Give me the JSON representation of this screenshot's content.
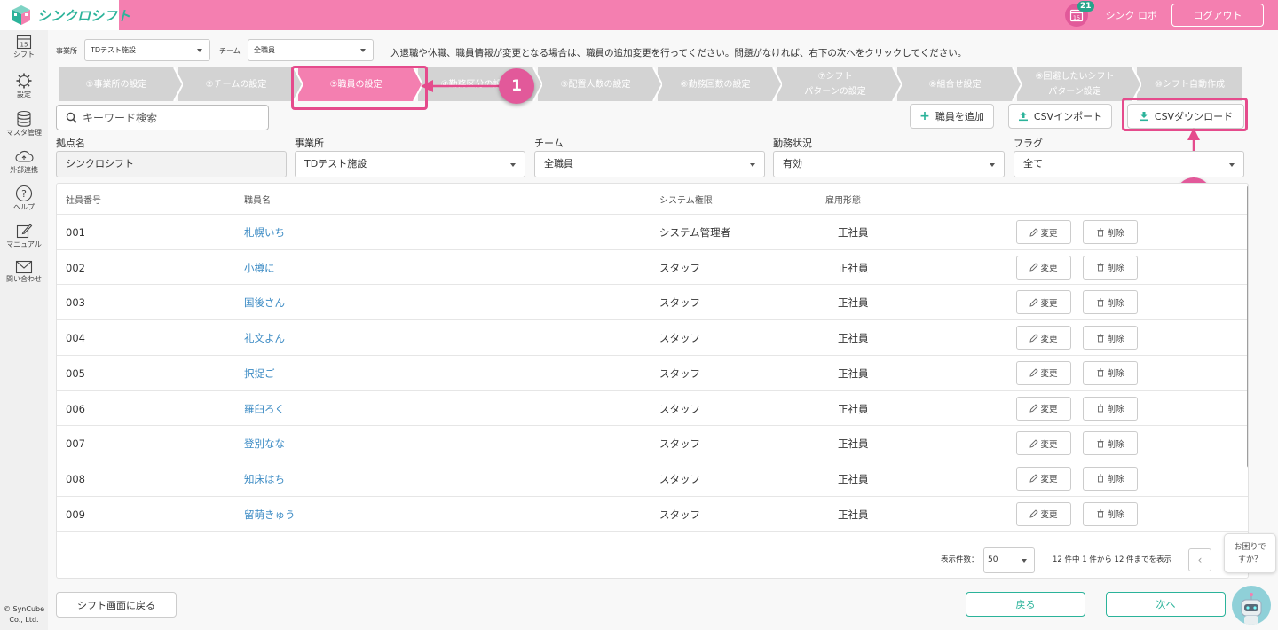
{
  "app": {
    "logo_text": "シンクロシフト",
    "calendar_day": "15",
    "notification_count": "21",
    "user_name": "シンク ロボ",
    "logout_label": "ログアウト"
  },
  "sidebar": {
    "items": [
      {
        "label": "シフト",
        "icon": "calendar-icon",
        "calendar_day": "15"
      },
      {
        "label": "設定",
        "icon": "gear-icon"
      },
      {
        "label": "マスタ管理",
        "icon": "database-icon"
      },
      {
        "label": "外部連携",
        "icon": "cloud-icon"
      },
      {
        "label": "ヘルプ",
        "icon": "help-icon"
      },
      {
        "label": "マニュアル",
        "icon": "manual-icon"
      },
      {
        "label": "問い合わせ",
        "icon": "mail-icon"
      }
    ],
    "copyright_line1": "© SynCube",
    "copyright_line2": "Co., Ltd."
  },
  "top_filter": {
    "office_label": "事業所",
    "office_value": "TDテスト施設",
    "team_label": "チーム",
    "team_value": "全職員",
    "notice": "入退職や休職、職員情報が変更となる場合は、職員の追加変更を行ってください。問題がなければ、右下の次へをクリックしてください。"
  },
  "steps": [
    {
      "line1": "①事業所の設定",
      "line2": ""
    },
    {
      "line1": "②チームの設定",
      "line2": ""
    },
    {
      "line1": "③職員の設定",
      "line2": ""
    },
    {
      "line1": "④勤務区分の設定",
      "line2": ""
    },
    {
      "line1": "⑤配置人数の設定",
      "line2": ""
    },
    {
      "line1": "⑥勤務回数の設定",
      "line2": ""
    },
    {
      "line1": "⑦シフト",
      "line2": "パターンの設定"
    },
    {
      "line1": "⑧組合せ設定",
      "line2": ""
    },
    {
      "line1": "⑨回避したいシフト",
      "line2": "パターン設定"
    },
    {
      "line1": "⑩シフト自動作成",
      "line2": ""
    }
  ],
  "callouts": [
    "1",
    "2"
  ],
  "colors": {
    "header_pink": "#f47fb0",
    "highlight_pink": "#e54b8c",
    "accent_green": "#2bb39a",
    "link_blue": "#3c8bc4"
  },
  "search": {
    "placeholder": "キーワード検索"
  },
  "actions": {
    "add_label": "職員を追加",
    "import_label": "CSVインポート",
    "download_label": "CSVダウンロード"
  },
  "filters": [
    {
      "label": "拠点名",
      "value": "シンクロシフト"
    },
    {
      "label": "事業所",
      "value": "TDテスト施設"
    },
    {
      "label": "チーム",
      "value": "全職員"
    },
    {
      "label": "勤務状況",
      "value": "有効"
    },
    {
      "label": "フラグ",
      "value": "全て"
    }
  ],
  "table": {
    "headers": [
      "社員番号",
      "職員名",
      "システム権限",
      "雇用形態"
    ],
    "edit_label": "変更",
    "delete_label": "削除",
    "rows": [
      {
        "id": "001",
        "name": "札幌いち",
        "role": "システム管理者",
        "type": "正社員"
      },
      {
        "id": "002",
        "name": "小樽に",
        "role": "スタッフ",
        "type": "正社員"
      },
      {
        "id": "003",
        "name": "国後さん",
        "role": "スタッフ",
        "type": "正社員"
      },
      {
        "id": "004",
        "name": "礼文よん",
        "role": "スタッフ",
        "type": "正社員"
      },
      {
        "id": "005",
        "name": "択捉ご",
        "role": "スタッフ",
        "type": "正社員"
      },
      {
        "id": "006",
        "name": "羅臼ろく",
        "role": "スタッフ",
        "type": "正社員"
      },
      {
        "id": "007",
        "name": "登別なな",
        "role": "スタッフ",
        "type": "正社員"
      },
      {
        "id": "008",
        "name": "知床はち",
        "role": "スタッフ",
        "type": "正社員"
      },
      {
        "id": "009",
        "name": "留萌きゅう",
        "role": "スタッフ",
        "type": "正社員"
      }
    ]
  },
  "pager": {
    "per_page_label": "表示件数：",
    "per_page_value": "50",
    "range_text": "12 件中 1 件から 12 件までを表示",
    "prev_label": "‹"
  },
  "footer": {
    "back_shift_label": "シフト画面に戻る",
    "back_label": "戻る",
    "next_label": "次へ"
  },
  "help": {
    "line1": "お困りで",
    "line2": "すか？"
  }
}
